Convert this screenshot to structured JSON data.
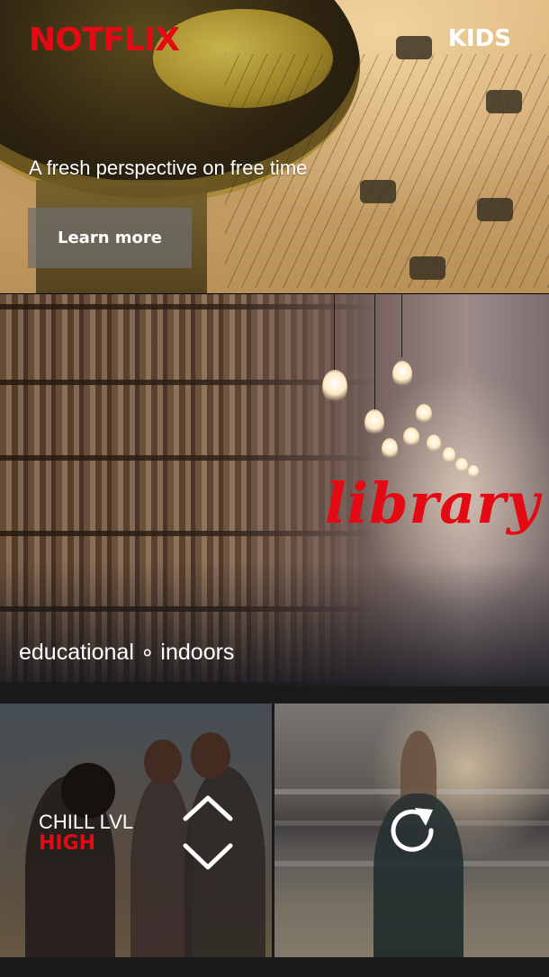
{
  "header": {
    "brand": "NOTFLIX",
    "kids_label": "KIDS"
  },
  "hero": {
    "title": "A fresh perspective on free time",
    "cta_label": "Learn more"
  },
  "library_card": {
    "title": "library",
    "tags": "educational ∘ indoors"
  },
  "chill_card": {
    "label": "CHILL LVL",
    "level": "HIGH",
    "up_icon": "chevron-up-icon",
    "down_icon": "chevron-down-icon"
  },
  "yoga_card": {
    "icon": "refresh-icon"
  },
  "colors": {
    "brand_red": "#e50914",
    "text_white": "#ffffff",
    "background": "#1a1a1a"
  }
}
